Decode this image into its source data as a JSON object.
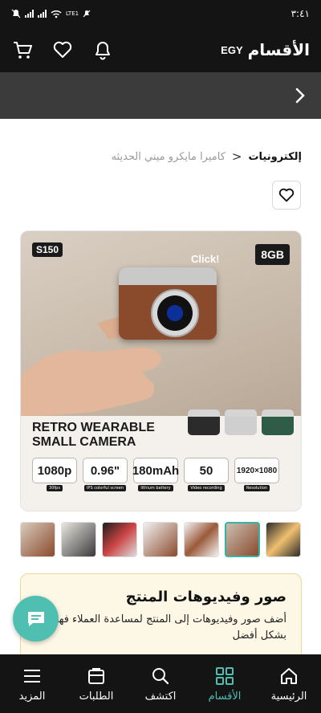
{
  "status_bar": {
    "time": "٣:٤١",
    "network_a": "Vo)\nLTE2",
    "network_b": "LTE1"
  },
  "header": {
    "brand_egy": "EGY",
    "brand_name": "الأقسام"
  },
  "breadcrumb": {
    "root": "إلكترونيات",
    "separator": "<",
    "current": "كاميرا مايكرو ميني الحديثه"
  },
  "product_image": {
    "model_badge": "S150",
    "storage_badge": "8GB",
    "click_text": "Click!",
    "title_line1": "RETRO WEARABLE",
    "title_line2": "SMALL CAMERA",
    "specs": [
      {
        "value": "1080p",
        "label": "30fps"
      },
      {
        "value": "0.96\"",
        "label": "IPS colorful screen"
      },
      {
        "value": "180mAh",
        "label": "lithium battery"
      },
      {
        "value": "50",
        "label": "Video recording"
      },
      {
        "value": "1920×1080",
        "label": "Resolution"
      }
    ]
  },
  "media_card": {
    "title": "صور وفيديوهات المنتج",
    "description": "أضف صور وفيديوهات إلى المنتج لمساعدة العملاء فهمه بشكل أفضل"
  },
  "bottom_nav": {
    "home": "الرئيسية",
    "categories": "الأقسام",
    "explore": "اكتشف",
    "orders": "الطلبات",
    "more": "المزيد"
  },
  "colors": {
    "accent": "#4fbfb1",
    "dark_bar": "#141414",
    "subheader": "#3b3b3b",
    "card_bg": "#fdf7e6"
  }
}
